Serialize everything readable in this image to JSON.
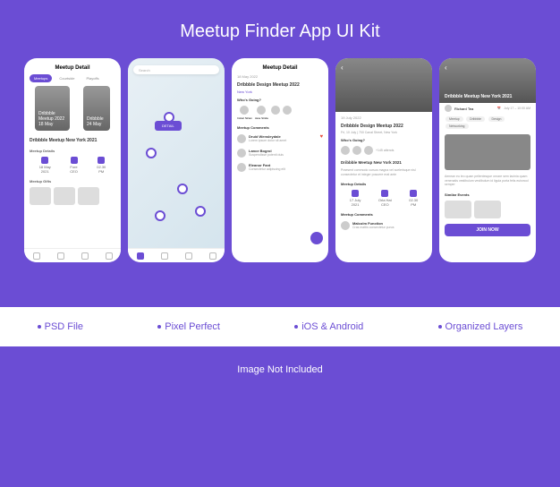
{
  "title": "Meetup Finder App UI Kit",
  "features": [
    "PSD File",
    "Pixel Perfect",
    "iOS & Android",
    "Organized Layers"
  ],
  "footer": "Image Not Included",
  "s1": {
    "title": "Meetup Detail",
    "tabs": [
      "Meetups",
      "Courtside",
      "Playoffs"
    ],
    "hero1": "Dribbble Meetup 2022",
    "hero1date": "18 May",
    "hero2": "Dribbble",
    "hero2date": "24 May",
    "eventTitle": "Dribbble Meetup New York 2021",
    "detailsH": "Meetup Details",
    "details": [
      {
        "label": "18 May",
        "sub": "2021"
      },
      {
        "label": "Fore",
        "sub": "CEO"
      },
      {
        "label": "02.30",
        "sub": "PM"
      }
    ],
    "giftsH": "Meetup Gifts"
  },
  "s2": {
    "searchPlaceholder": "Search",
    "detailBtn": "DETAIL"
  },
  "s3": {
    "title": "Meetup Detail",
    "date": "18 May 2022",
    "eventTitle": "Dribbble Design Meetup 2022",
    "loc": "New York",
    "whosH": "Who's Going?",
    "attendees": [
      "Imtiaz Nirtan",
      "Jane Stride",
      ""
    ],
    "commentsH": "Meetup Comments",
    "comments": [
      {
        "name": "Druid Wensleydale",
        "text": "Lorem ipsum dolor sit amet"
      },
      {
        "name": "Lance Bogrol",
        "text": "Suspendisse potenti duis"
      },
      {
        "name": "Eleanor Fant",
        "text": "Consectetur adipiscing elit"
      }
    ]
  },
  "s4": {
    "title": "Meetup Detail",
    "date": "19 July 2022",
    "eventTitle": "Dribbble Design Meetup 2022",
    "meta": "Fri, 10 July  |  700 Canal Street, New York",
    "whosH": "Who's Going?",
    "attending": "+145 attends",
    "heading": "Dribbble Meetup New York 2021",
    "desc": "Praesent commodo cursus magna vel scelerisque nisl consectetur et integer posuere erat ante",
    "detailsH": "Meetup Details",
    "details": [
      {
        "label": "17 July",
        "sub": "2021"
      },
      {
        "label": "Orla Hat",
        "sub": "CEO"
      },
      {
        "label": "02.30",
        "sub": "PM"
      }
    ],
    "commentsH": "Meetup Comments",
    "comment": {
      "name": "Malcolm Function",
      "text": "Cras mattis consectetur purus"
    }
  },
  "s5": {
    "eventTitle": "Dribbble Meetup New York 2021",
    "author": "Richard Tea",
    "pills": [
      "Meetup",
      "Dribbble",
      "Design",
      "Networking"
    ],
    "date": "July 17 – 10:00 AM",
    "desc": "Aenean eu leo quam pellentesque ornare sem lacinia quam venenatis vestibulum vestibulum id ligula porta felis euismod semper",
    "similarH": "Similar Events",
    "joinBtn": "JOIN NOW"
  }
}
